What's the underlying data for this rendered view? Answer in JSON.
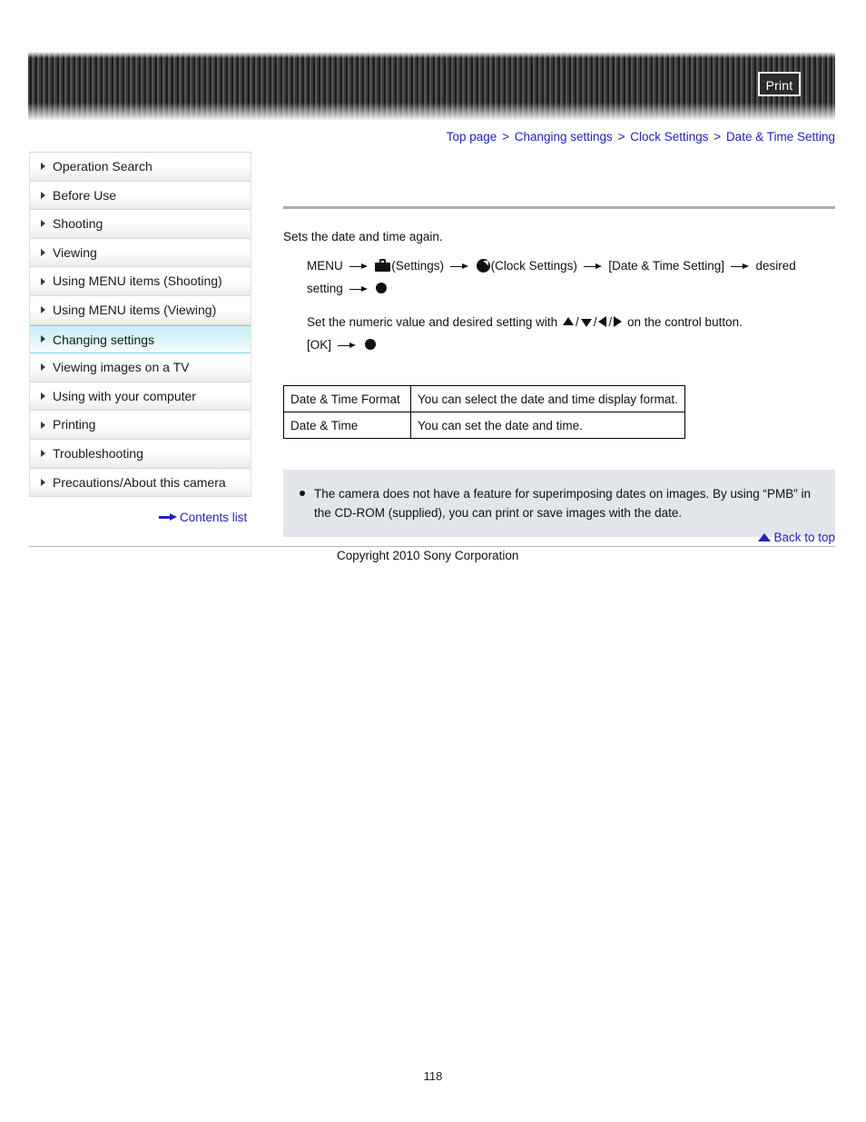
{
  "header": {
    "print_label": "Print"
  },
  "breadcrumb": {
    "separator": ">",
    "items": [
      {
        "label": "Top page"
      },
      {
        "label": "Changing settings"
      },
      {
        "label": "Clock Settings"
      },
      {
        "label": "Date & Time Setting"
      }
    ]
  },
  "sidebar": {
    "items": [
      {
        "label": "Operation Search"
      },
      {
        "label": "Before Use"
      },
      {
        "label": "Shooting"
      },
      {
        "label": "Viewing"
      },
      {
        "label": "Using MENU items (Shooting)"
      },
      {
        "label": "Using MENU items (Viewing)"
      },
      {
        "label": "Changing settings"
      },
      {
        "label": "Viewing images on a TV"
      },
      {
        "label": "Using with your computer"
      },
      {
        "label": "Printing"
      },
      {
        "label": "Troubleshooting"
      },
      {
        "label": "Precautions/About this camera"
      }
    ],
    "active_index": 6,
    "contents_list_label": "Contents list"
  },
  "main": {
    "lead": "Sets the date and time again.",
    "instruction1": {
      "menu": "MENU",
      "settings": "(Settings)",
      "clock": "(Clock Settings)",
      "bracket": "[Date & Time Setting]",
      "desired": "desired",
      "setting": "setting"
    },
    "instruction2": {
      "prefix": "Set the numeric value and desired setting with",
      "slash": "/",
      "suffix": "on the control button.",
      "ok": "[OK]"
    },
    "table": {
      "rows": [
        {
          "name": "Date & Time Format",
          "desc": "You can select the date and time display format."
        },
        {
          "name": "Date & Time",
          "desc": "You can set the date and time."
        }
      ]
    },
    "note": {
      "text": "The camera does not have a feature for superimposing dates on images. By using “PMB” in the CD-ROM (supplied), you can print or save images with the date."
    }
  },
  "footer": {
    "back_to_top_label": "Back to top",
    "copyright": "Copyright 2010 Sony Corporation",
    "page_number": "118"
  }
}
